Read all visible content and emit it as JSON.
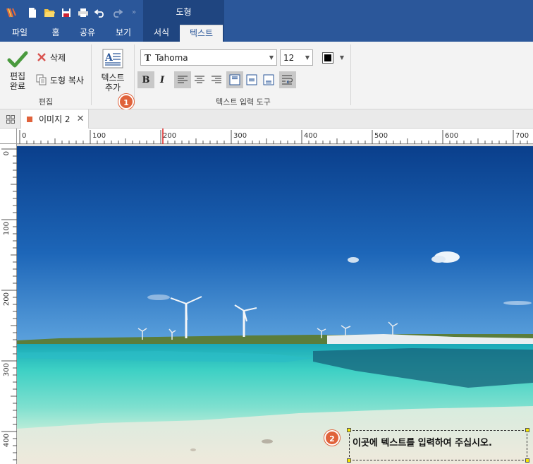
{
  "title_bar": {
    "context_group_label": "도형",
    "bg_color": "#2b579a",
    "context_color": "#1f4580"
  },
  "quick_access": [
    "app-logo-icon",
    "new-file-icon",
    "open-folder-icon",
    "save-icon",
    "print-icon",
    "undo-icon",
    "redo-icon",
    "more-icon"
  ],
  "tabs": [
    {
      "label": "파일"
    },
    {
      "label": "홈"
    },
    {
      "label": "공유"
    },
    {
      "label": "보기"
    },
    {
      "label": "서식"
    },
    {
      "label": "텍스트",
      "active": true
    }
  ],
  "ribbon": {
    "edit_group": {
      "finish_label_1": "편집",
      "finish_label_2": "완료",
      "delete_label": "삭제",
      "copy_shape_label": "도형 복사",
      "group_label": "편집"
    },
    "add_text": {
      "label_1": "텍스트",
      "label_2": "추가"
    },
    "text_tools": {
      "font_name": "Tahoma",
      "font_size": "12",
      "color": "#000000",
      "bold_label": "B",
      "italic_label": "I",
      "group_label": "텍스트 입력 도구"
    }
  },
  "badges": {
    "one": "1",
    "two": "2"
  },
  "document": {
    "tab_label": "이미지 2",
    "accent": "#e0623b"
  },
  "rulers": {
    "horizontal": [
      "0",
      "100",
      "200",
      "300",
      "400",
      "500",
      "600",
      "700"
    ],
    "vertical": [
      "0",
      "100",
      "200",
      "300",
      "400"
    ]
  },
  "canvas": {
    "textbox_text": "이곳에 텍스트를 입력하여 주십시오."
  }
}
